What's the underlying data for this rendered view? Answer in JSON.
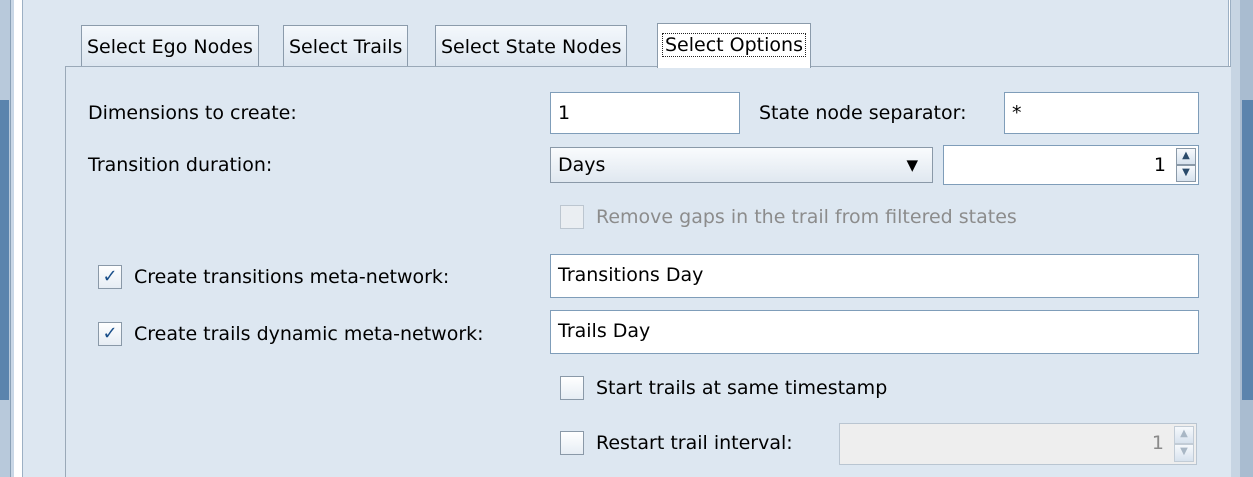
{
  "tabs": [
    {
      "label": "Select Ego Nodes"
    },
    {
      "label": "Select Trails"
    },
    {
      "label": "Select State Nodes"
    },
    {
      "label": "Select Options"
    }
  ],
  "options": {
    "dimensions_label": "Dimensions to create:",
    "dimensions_value": "1",
    "separator_label": "State node separator:",
    "separator_value": "*",
    "duration_label": "Transition duration:",
    "duration_unit": "Days",
    "duration_value": "1",
    "remove_gaps_label": "Remove gaps in the trail from filtered states",
    "remove_gaps_checked": false,
    "transitions_label": "Create transitions meta-network:",
    "transitions_checked": true,
    "transitions_value": "Transitions Day",
    "trails_label": "Create trails dynamic meta-network:",
    "trails_checked": true,
    "trails_value": "Trails Day",
    "start_same_label": "Start trails at same timestamp",
    "start_same_checked": false,
    "restart_label": "Restart trail interval:",
    "restart_checked": false,
    "restart_value": "1",
    "check_mark": "✓",
    "dropdown_arrow": "▼",
    "spin_up": "▲",
    "spin_down": "▼"
  }
}
